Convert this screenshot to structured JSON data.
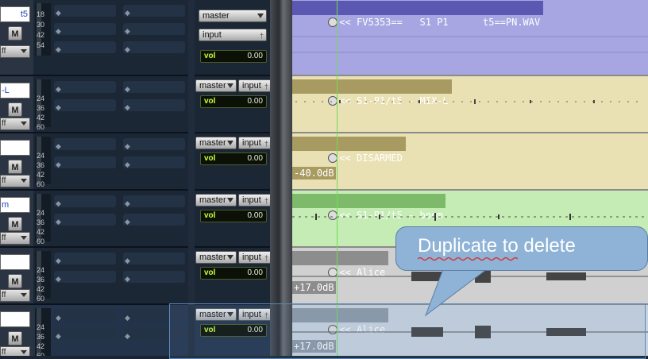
{
  "tracks": [
    {
      "name_partial": "t5",
      "mute_label": "M",
      "off_label": "ff",
      "meter_scale": [
        "18",
        "30",
        "42",
        "54"
      ],
      "output": "master",
      "input": "input",
      "vol_label": "vol",
      "vol_value": "0.00"
    },
    {
      "name_partial": "-L",
      "mute_label": "M",
      "off_label": "ff",
      "meter_scale": [
        "24",
        "36",
        "42",
        "60"
      ],
      "output": "master",
      "input": "input",
      "vol_label": "vol",
      "vol_value": "0.00"
    },
    {
      "name_partial": "",
      "mute_label": "M",
      "off_label": "ff",
      "meter_scale": [
        "24",
        "36",
        "42",
        "60"
      ],
      "output": "master",
      "input": "input",
      "vol_label": "vol",
      "vol_value": "0.00"
    },
    {
      "name_partial": "m",
      "mute_label": "M",
      "off_label": "ff",
      "meter_scale": [
        "24",
        "36",
        "42",
        "60"
      ],
      "output": "master",
      "input": "input",
      "vol_label": "vol",
      "vol_value": "0.00"
    },
    {
      "name_partial": "",
      "mute_label": "M",
      "off_label": "ff",
      "meter_scale": [
        "24",
        "36",
        "42",
        "60"
      ],
      "output": "master",
      "input": "input",
      "vol_label": "vol",
      "vol_value": "0.00"
    },
    {
      "name_partial": "",
      "mute_label": "M",
      "off_label": "ff",
      "meter_scale": [
        "24",
        "36",
        "42",
        "60"
      ],
      "output": "master",
      "input": "input",
      "vol_label": "vol",
      "vol_value": "0.00"
    }
  ],
  "clips": [
    {
      "name": "FV5353==   S1 P1      t5==PN.WAV",
      "prefix": "<<",
      "gain": "",
      "color": "#a7a6e2",
      "label_bg": "#5a58b0"
    },
    {
      "name": "S1-P1/t5 - MIX-L",
      "prefix": "<<",
      "gain": "",
      "color": "#e9e1b4",
      "label_bg": "#a89b62"
    },
    {
      "name": "DISARMED",
      "prefix": "<<",
      "gain": "-40.0dB",
      "color": "#e9e1b4",
      "label_bg": "#a89b62"
    },
    {
      "name": "S1-P1/t5 - boom",
      "prefix": "<<",
      "gain": "",
      "color": "#c5ecb5",
      "label_bg": "#7dbb6a"
    },
    {
      "name": "Alice",
      "prefix": "<<",
      "gain": "+17.0dB",
      "color": "#d0d0d0",
      "label_bg": "#8d8d8d"
    },
    {
      "name": "Alice",
      "prefix": "<<",
      "gain": "+17.0dB",
      "color": "#c9d3df",
      "label_bg": "#8f9aa7"
    }
  ],
  "callout": {
    "text": "Duplicate to delete"
  },
  "colors": {
    "cursor": "#6fdc55",
    "vol_text": "#c6ff3a",
    "selection": "#5b87b8"
  }
}
